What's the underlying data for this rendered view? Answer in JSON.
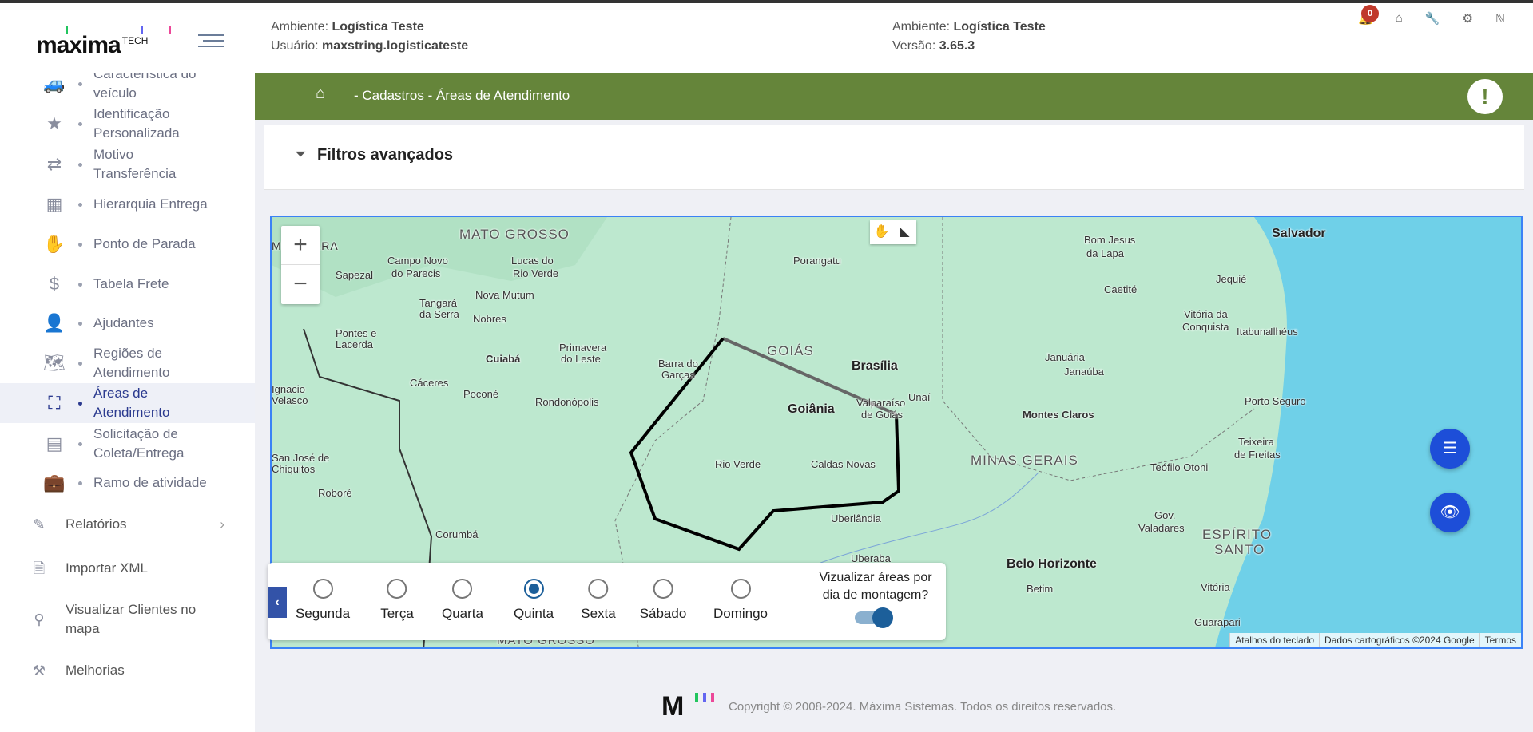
{
  "header": {
    "env_label": "Ambiente:",
    "env_value": "Logística Teste",
    "user_label": "Usuário:",
    "user_value": "maxstring.logisticateste",
    "env2_label": "Ambiente:",
    "env2_value": "Logística Teste",
    "version_label": "Versão:",
    "version_value": "3.65.3",
    "notifications": "0",
    "logo_text": "maxima",
    "logo_sup": "TECH"
  },
  "sidebar": {
    "items": [
      {
        "label": "Característica do veículo",
        "icon": "car-icon"
      },
      {
        "label": "Identificação Personalizada",
        "icon": "star-icon"
      },
      {
        "label": "Motivo Transferência",
        "icon": "transfer-icon"
      },
      {
        "label": "Hierarquia Entrega",
        "icon": "boxes-icon"
      },
      {
        "label": "Ponto de Parada",
        "icon": "hand-icon"
      },
      {
        "label": "Tabela Frete",
        "icon": "money-icon"
      },
      {
        "label": "Ajudantes",
        "icon": "user-icon"
      },
      {
        "label": "Regiões de Atendimento",
        "icon": "map-icon"
      },
      {
        "label": "Áreas de Atendimento",
        "icon": "area-icon"
      },
      {
        "label": "Solicitação de Coleta/Entrega",
        "icon": "pallet-icon"
      },
      {
        "label": "Ramo de atividade",
        "icon": "briefcase-icon"
      }
    ],
    "top": [
      {
        "label": "Relatórios",
        "icon": "edit-icon"
      },
      {
        "label": "Importar XML",
        "icon": "file-icon"
      },
      {
        "label": "Visualizar Clientes no mapa",
        "icon": "pin-icon"
      },
      {
        "label": "Melhorias",
        "icon": "tools-icon"
      }
    ]
  },
  "breadcrumb": {
    "text": "- Cadastros - Áreas de Atendimento"
  },
  "filters": {
    "title": "Filtros avançados"
  },
  "map": {
    "labels": [
      "MATO GROSSO",
      "GOIÁS",
      "MINAS GERAIS",
      "ESPÍRITO",
      "SANTO",
      "Salvador",
      "Brasília",
      "Goiânia",
      "Belo Horizonte",
      "Cuiabá",
      "Porangatu",
      "Bom Jesus",
      "da Lapa",
      "Caetité",
      "Jequié",
      "Vitória da",
      "Conquista",
      "Itabuna",
      "Ilhéus",
      "Januária",
      "Janaúba",
      "Unaí",
      "Valparaíso",
      "de Goiás",
      "Montes Claros",
      "Porto Seguro",
      "Teixeira",
      "de Freitas",
      "Teófilo Otoni",
      "Gov.",
      "Valadares",
      "Rio Verde",
      "Caldas Novas",
      "Uberlândia",
      "Uberaba",
      "Vitória",
      "Guarapari",
      "Betim",
      "Campo Novo",
      "do Parecis",
      "Lucas do",
      "Rio Verde",
      "Sapezal",
      "Nova Mutum",
      "Tangará",
      "da Serra",
      "Nobres",
      "Pontes e",
      "Lacerda",
      "Primavera",
      "do Leste",
      "Barra do",
      "Garças",
      "Cáceres",
      "Poconé",
      "Rondonópolis",
      "Ignacio",
      "Velasco",
      "San José de",
      "Chiquitos",
      "Roboré",
      "Corumbá",
      "MBIKWARA",
      "MATO GROSSO"
    ],
    "attribution": [
      "Atalhos do teclado",
      "Dados cartográficos ©2024 Google",
      "Termos"
    ],
    "colors": {
      "land": "#bde8cf",
      "water": "#6fd0e8",
      "polygon": "#000000"
    }
  },
  "days": {
    "options": [
      "Segunda",
      "Terça",
      "Quarta",
      "Quinta",
      "Sexta",
      "Sábado",
      "Domingo"
    ],
    "selected": "Quinta",
    "toggle_label": "Vizualizar áreas por dia de montagem?",
    "toggle_on": true
  },
  "footer": {
    "copyright": "Copyright © 2008-2024. Máxima Sistemas. Todos os direitos reservados."
  }
}
